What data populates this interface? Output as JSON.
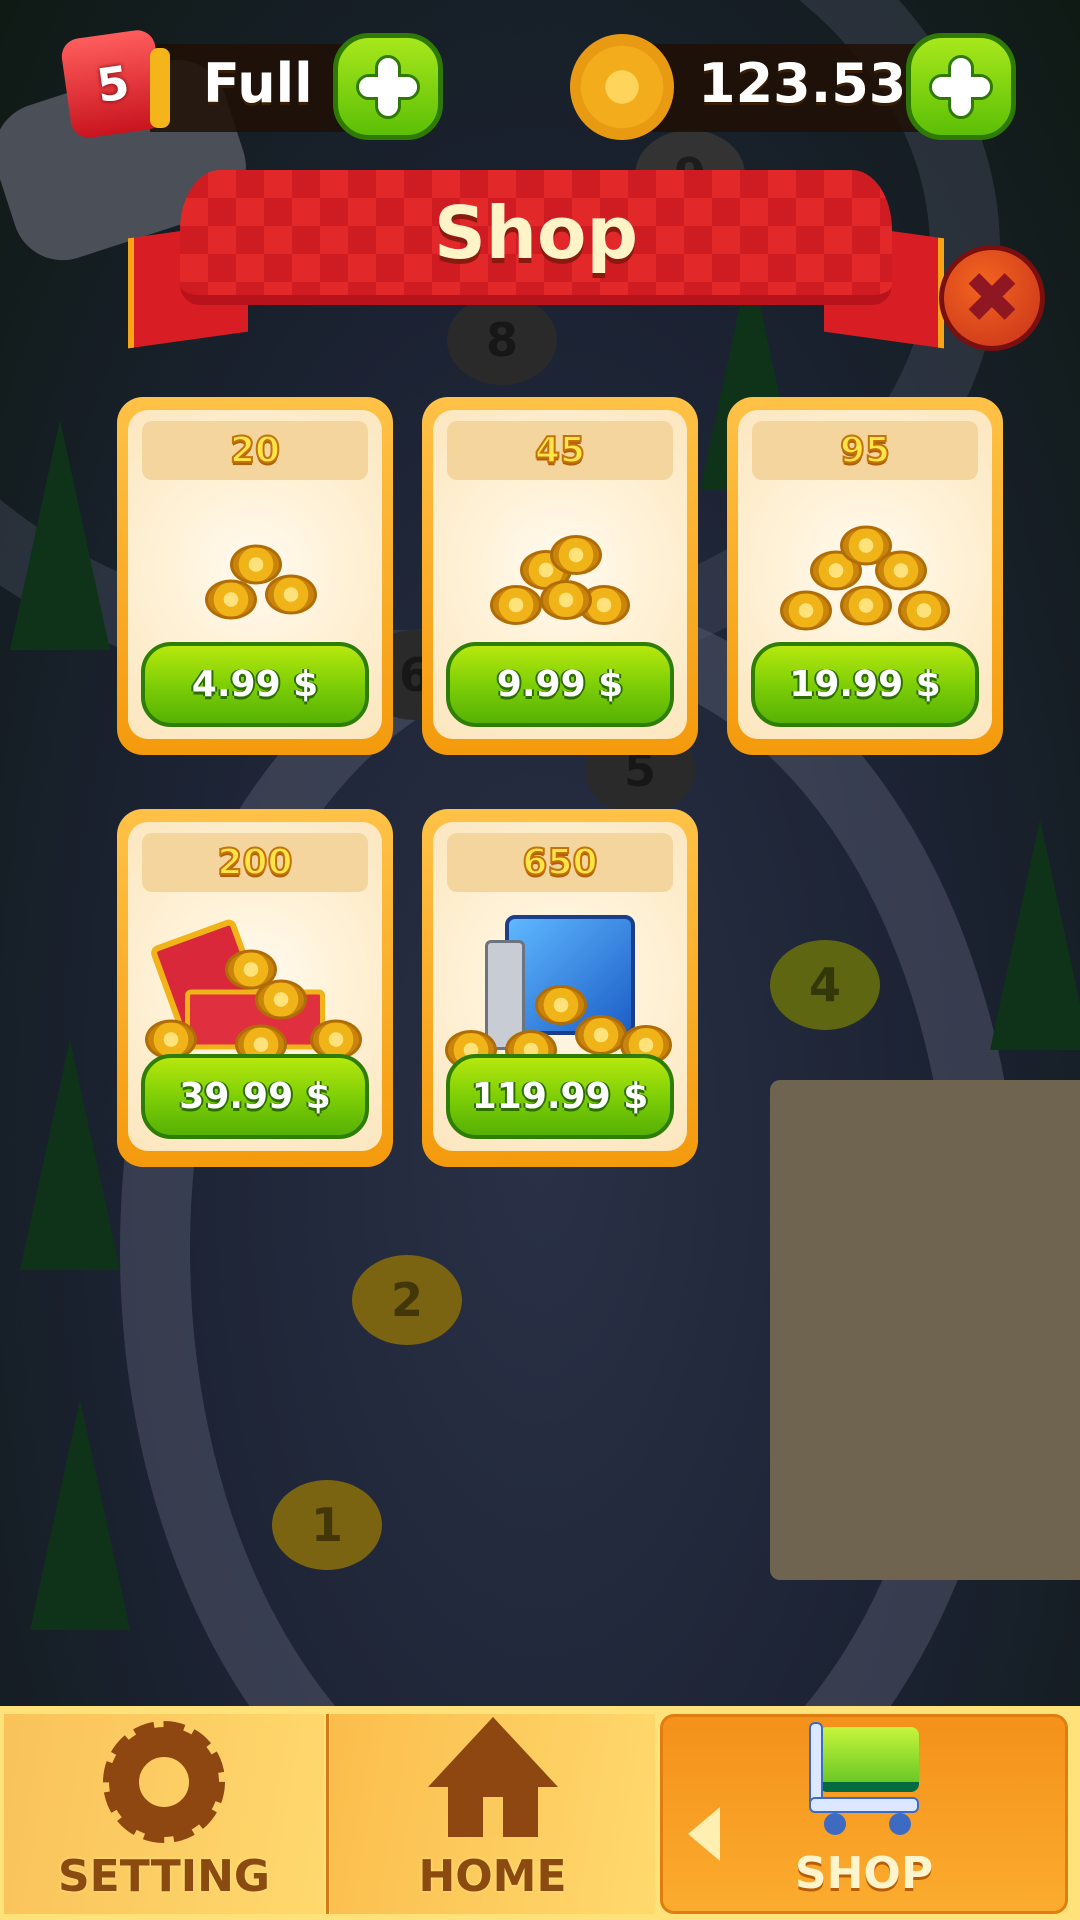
{
  "topbar": {
    "fuel_count": "5",
    "fuel_status": "Full",
    "coins": "123.530"
  },
  "shop": {
    "title": "Shop",
    "packs": [
      {
        "amount": "20",
        "price": "4.99 $",
        "art": "coin-pile-small"
      },
      {
        "amount": "45",
        "price": "9.99 $",
        "art": "coin-pile-medium"
      },
      {
        "amount": "95",
        "price": "19.99 $",
        "art": "coin-pile-large"
      },
      {
        "amount": "200",
        "price": "39.99 $",
        "art": "treasure-chest"
      },
      {
        "amount": "650",
        "price": "119.99 $",
        "art": "safe-vault"
      }
    ]
  },
  "map": {
    "levels": [
      "9",
      "8",
      "6",
      "5",
      "4",
      "2",
      "1"
    ]
  },
  "nav": {
    "items": [
      {
        "label": "SETTING",
        "icon": "gear-icon"
      },
      {
        "label": "HOME",
        "icon": "home-icon"
      },
      {
        "label": "SHOP",
        "icon": "cart-icon"
      }
    ],
    "active": "SHOP"
  },
  "colors": {
    "accent_green": "#7fcf06",
    "card_orange": "#f49a0c",
    "banner_red": "#e3282a",
    "nav_yellow": "#ffe27a"
  }
}
